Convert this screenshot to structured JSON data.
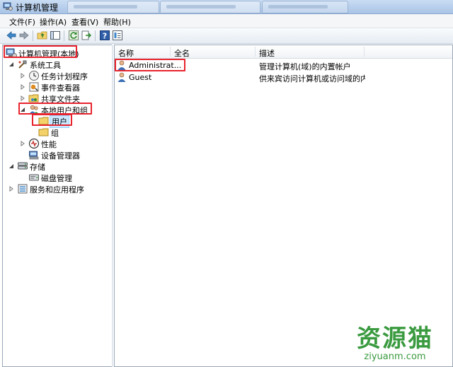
{
  "window": {
    "title": "计算机管理"
  },
  "menubar": {
    "items": [
      "文件(F)",
      "操作(A)",
      "查看(V)",
      "帮助(H)"
    ]
  },
  "toolbar": {
    "buttons": [
      "back-icon",
      "forward-icon",
      "up-folder-icon",
      "show-tree-icon",
      "refresh-icon",
      "export-icon",
      "help-icon",
      "properties-icon"
    ]
  },
  "tree": {
    "root": "计算机管理(本地)",
    "system_tools": "系统工具",
    "task_scheduler": "任务计划程序",
    "event_viewer": "事件查看器",
    "shared_folders": "共享文件夹",
    "local_users_groups": "本地用户和组",
    "users": "用户",
    "groups": "组",
    "performance": "性能",
    "device_manager": "设备管理器",
    "storage": "存储",
    "disk_management": "磁盘管理",
    "services_apps": "服务和应用程序"
  },
  "list": {
    "columns": [
      "名称",
      "全名",
      "描述"
    ],
    "rows": [
      {
        "name": "Administrat...",
        "full_name": "",
        "description": "管理计算机(域)的内置帐户"
      },
      {
        "name": "Guest",
        "full_name": "",
        "description": "供来宾访问计算机或访问域的内..."
      }
    ]
  },
  "watermark": {
    "brand": "资源猫",
    "url": "ziyuanm.com"
  },
  "colors": {
    "highlight": "#e8242e",
    "watermark": "#3a9a3f",
    "selection": "#cce8ff"
  }
}
